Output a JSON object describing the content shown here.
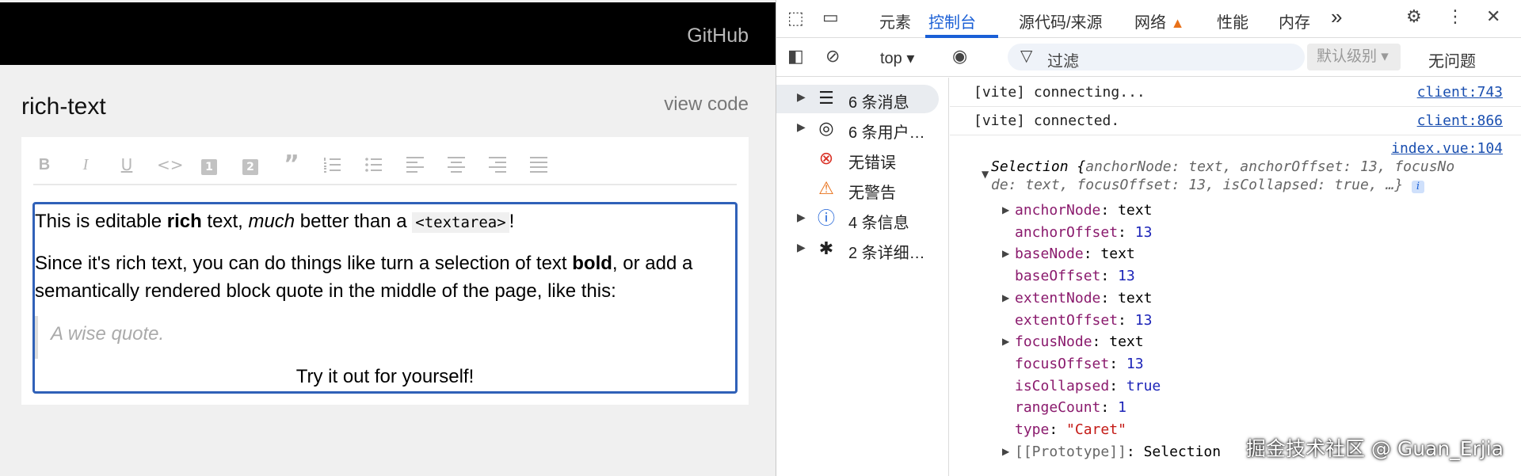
{
  "app": {
    "github": "GitHub",
    "title": "rich-text",
    "view_code": "view code",
    "toolbar": [
      "B",
      "I",
      "U",
      "<>",
      "1",
      "2",
      "”",
      "numbered-list",
      "bulleted-list",
      "align-left",
      "align-center",
      "align-right",
      "justify"
    ],
    "editor": {
      "p1_a": "This is editable ",
      "p1_b": "rich",
      "p1_c": " text, ",
      "p1_d": "much",
      "p1_e": " better than a ",
      "p1_code": "<textarea>",
      "p1_f": "!",
      "p2_a": "Since it's rich text, you can do things like turn a selection of text ",
      "p2_b": "bold",
      "p2_c": ", or add a semantically rendered block quote in the middle of the page, like this:",
      "quote": "A wise quote.",
      "try": "Try it out for yourself!"
    }
  },
  "devtools": {
    "tabs": [
      "元素",
      "控制台",
      "源代码/来源",
      "网络",
      "性能",
      "内存"
    ],
    "active_tab": "控制台",
    "more": "»",
    "context": "top ▾",
    "filter_placeholder": "过滤",
    "level": "默认级别 ▾",
    "no_issues": "无问题",
    "sidebar": [
      {
        "label": "6 条消息",
        "icon": "list-icon"
      },
      {
        "label": "6 条用户…",
        "icon": "user-icon"
      },
      {
        "label": "无错误",
        "icon": "error-icon"
      },
      {
        "label": "无警告",
        "icon": "warning-icon"
      },
      {
        "label": "4 条信息",
        "icon": "info-icon"
      },
      {
        "label": "2 条详细…",
        "icon": "bug-icon"
      }
    ],
    "logs": [
      {
        "text": "[vite] connecting...",
        "src": "client:743"
      },
      {
        "text": "[vite] connected.",
        "src": "client:866"
      }
    ],
    "selection": {
      "src": "index.vue:104",
      "header_a": "Selection {",
      "header_b": "anchorNode: text, anchorOffset: 13, focusNo",
      "header_c": "de: text, focusOffset: 13, isCollapsed: true, …}",
      "props": [
        {
          "key": "anchorNode",
          "val": "text",
          "expand": true,
          "kind": "plain"
        },
        {
          "key": "anchorOffset",
          "val": "13",
          "expand": false,
          "kind": "num"
        },
        {
          "key": "baseNode",
          "val": "text",
          "expand": true,
          "kind": "plain"
        },
        {
          "key": "baseOffset",
          "val": "13",
          "expand": false,
          "kind": "num"
        },
        {
          "key": "extentNode",
          "val": "text",
          "expand": true,
          "kind": "plain"
        },
        {
          "key": "extentOffset",
          "val": "13",
          "expand": false,
          "kind": "num"
        },
        {
          "key": "focusNode",
          "val": "text",
          "expand": true,
          "kind": "plain"
        },
        {
          "key": "focusOffset",
          "val": "13",
          "expand": false,
          "kind": "num"
        },
        {
          "key": "isCollapsed",
          "val": "true",
          "expand": false,
          "kind": "kw"
        },
        {
          "key": "rangeCount",
          "val": "1",
          "expand": false,
          "kind": "num"
        },
        {
          "key": "type",
          "val": "\"Caret\"",
          "expand": false,
          "kind": "str"
        },
        {
          "key": "[[Prototype]]",
          "val": "Selection",
          "expand": true,
          "kind": "plain"
        }
      ],
      "next_src": "index.vue:104"
    },
    "watermark": "掘金技术社区 @ Guan_Erjia"
  },
  "colors": {
    "accent": "#1a5fd6",
    "editor_border": "#3061b8",
    "warning": "#e8711a"
  }
}
